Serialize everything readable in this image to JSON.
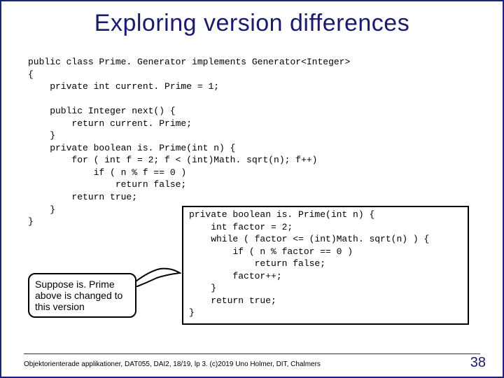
{
  "title": "Exploring version differences",
  "code_main": "public class Prime. Generator implements Generator<Integer>\n{\n    private int current. Prime = 1;\n\n    public Integer next() {\n        return current. Prime;\n    }\n    private boolean is. Prime(int n) {\n        for ( int f = 2; f < (int)Math. sqrt(n); f++)\n            if ( n % f == 0 )\n                return false;\n        return true;\n    }\n}",
  "code_box": "private boolean is. Prime(int n) {\n    int factor = 2;\n    while ( factor <= (int)Math. sqrt(n) ) {\n        if ( n % factor == 0 )\n            return false;\n        factor++;\n    }\n    return true;\n}",
  "callout_text": "Suppose is. Prime above is changed to this version",
  "footer": "Objektorienterade applikationer, DAT055, DAI2, 18/19, lp 3. (c)2019 Uno Holmer, DIT, Chalmers",
  "page_number": "38"
}
